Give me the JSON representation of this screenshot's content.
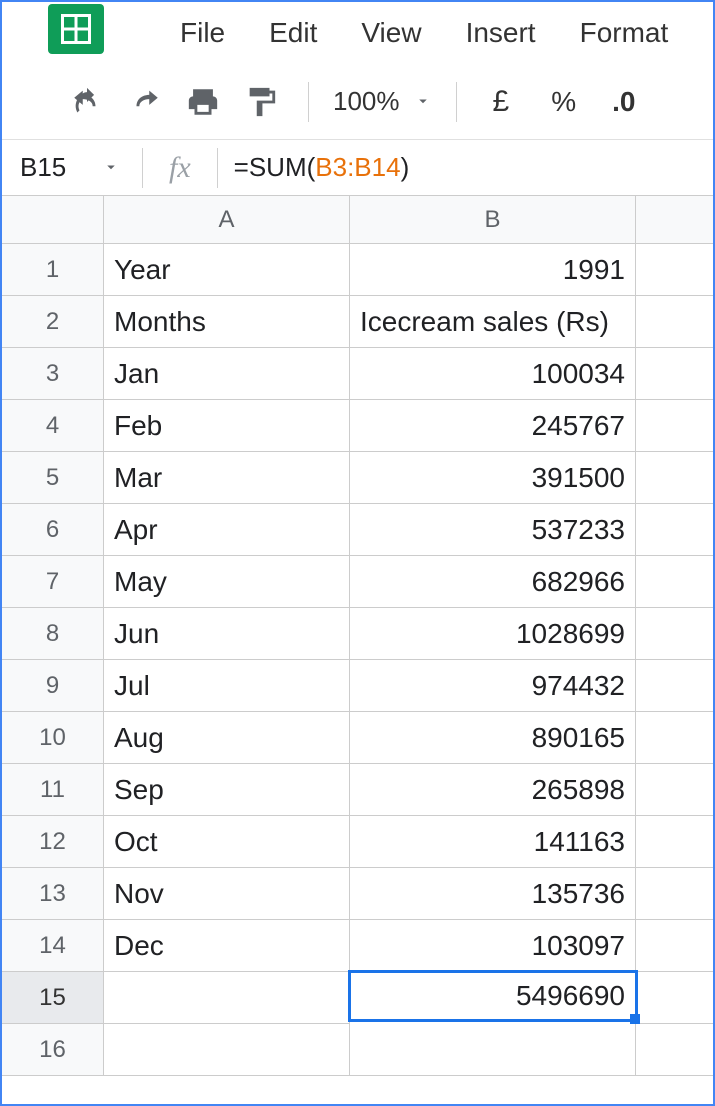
{
  "menu": {
    "file": "File",
    "edit": "Edit",
    "view": "View",
    "insert": "Insert",
    "format": "Format"
  },
  "toolbar": {
    "zoom": "100%",
    "currency": "£",
    "percent": "%",
    "decimal": ".0"
  },
  "fxbar": {
    "cellref": "B15",
    "fx": "fx",
    "formula_prefix": "=SUM(",
    "formula_range": "B3:B14",
    "formula_suffix": ")"
  },
  "colHeaders": {
    "a": "A",
    "b": "B"
  },
  "rowHeaders": [
    "1",
    "2",
    "3",
    "4",
    "5",
    "6",
    "7",
    "8",
    "9",
    "10",
    "11",
    "12",
    "13",
    "14",
    "15",
    "16"
  ],
  "cells": {
    "A1": "Year",
    "B1": "1991",
    "A2": "Months",
    "B2": "Icecream sales (Rs)",
    "A3": "Jan",
    "B3": "100034",
    "A4": "Feb",
    "B4": "245767",
    "A5": "Mar",
    "B5": "391500",
    "A6": "Apr",
    "B6": "537233",
    "A7": "May",
    "B7": "682966",
    "A8": "Jun",
    "B8": "1028699",
    "A9": "Jul",
    "B9": "974432",
    "A10": "Aug",
    "B10": "890165",
    "A11": "Sep",
    "B11": "265898",
    "A12": "Oct",
    "B12": "141163",
    "A13": "Nov",
    "B13": "135736",
    "A14": "Dec",
    "B14": "103097",
    "A15": "",
    "B15": "5496690",
    "A16": "",
    "B16": ""
  }
}
